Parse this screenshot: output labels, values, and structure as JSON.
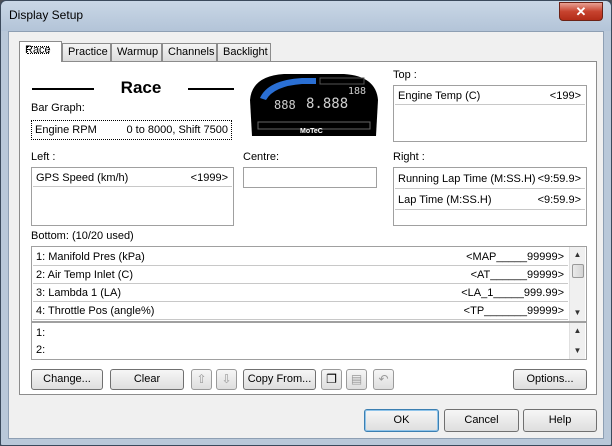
{
  "window": {
    "title": "Display Setup",
    "close_label": "✕"
  },
  "tabs": [
    {
      "label": "Race"
    },
    {
      "label": "Practice"
    },
    {
      "label": "Warmup"
    },
    {
      "label": "Channels"
    },
    {
      "label": "Backlight"
    }
  ],
  "race": {
    "heading": "Race",
    "bar_graph_label": "Bar Graph:",
    "bar_graph": {
      "channel": "Engine RPM",
      "value": "0 to 8000, Shift 7500"
    },
    "dash_preview": {
      "digits_left": "888",
      "digits_mid": "8.888",
      "digits_right": "188",
      "brand": "MoTeC"
    },
    "top_label": "Top :",
    "top_items": [
      {
        "channel": "Engine Temp (C)",
        "value": "<199>"
      }
    ],
    "left_label": "Left :",
    "left_items": [
      {
        "channel": "GPS Speed (km/h)",
        "value": "<1999>"
      }
    ],
    "centre_label": "Centre:",
    "right_label": "Right :",
    "right_items": [
      {
        "channel": "Running Lap Time (M:SS.H)",
        "value": "<9:59.9>"
      },
      {
        "channel": "Lap Time (M:SS.H)",
        "value": "<9:59.9>"
      }
    ],
    "bottom_label": "Bottom: (10/20 used)",
    "bottom_items": [
      {
        "channel": "1: Manifold Pres (kPa)",
        "value": "<MAP_____99999>"
      },
      {
        "channel": "2: Air Temp Inlet (C)",
        "value": "<AT______99999>"
      },
      {
        "channel": "3: Lambda 1 (LA)",
        "value": "<LA_1_____999.99>"
      },
      {
        "channel": "4: Throttle Pos (angle%)",
        "value": "<TP_______99999>"
      }
    ],
    "bottom_lines": [
      "1:",
      "2:"
    ]
  },
  "toolbar": {
    "change": "Change...",
    "clear": "Clear",
    "copy_from": "Copy From...",
    "options": "Options..."
  },
  "footer": {
    "ok": "OK",
    "cancel": "Cancel",
    "help": "Help"
  }
}
